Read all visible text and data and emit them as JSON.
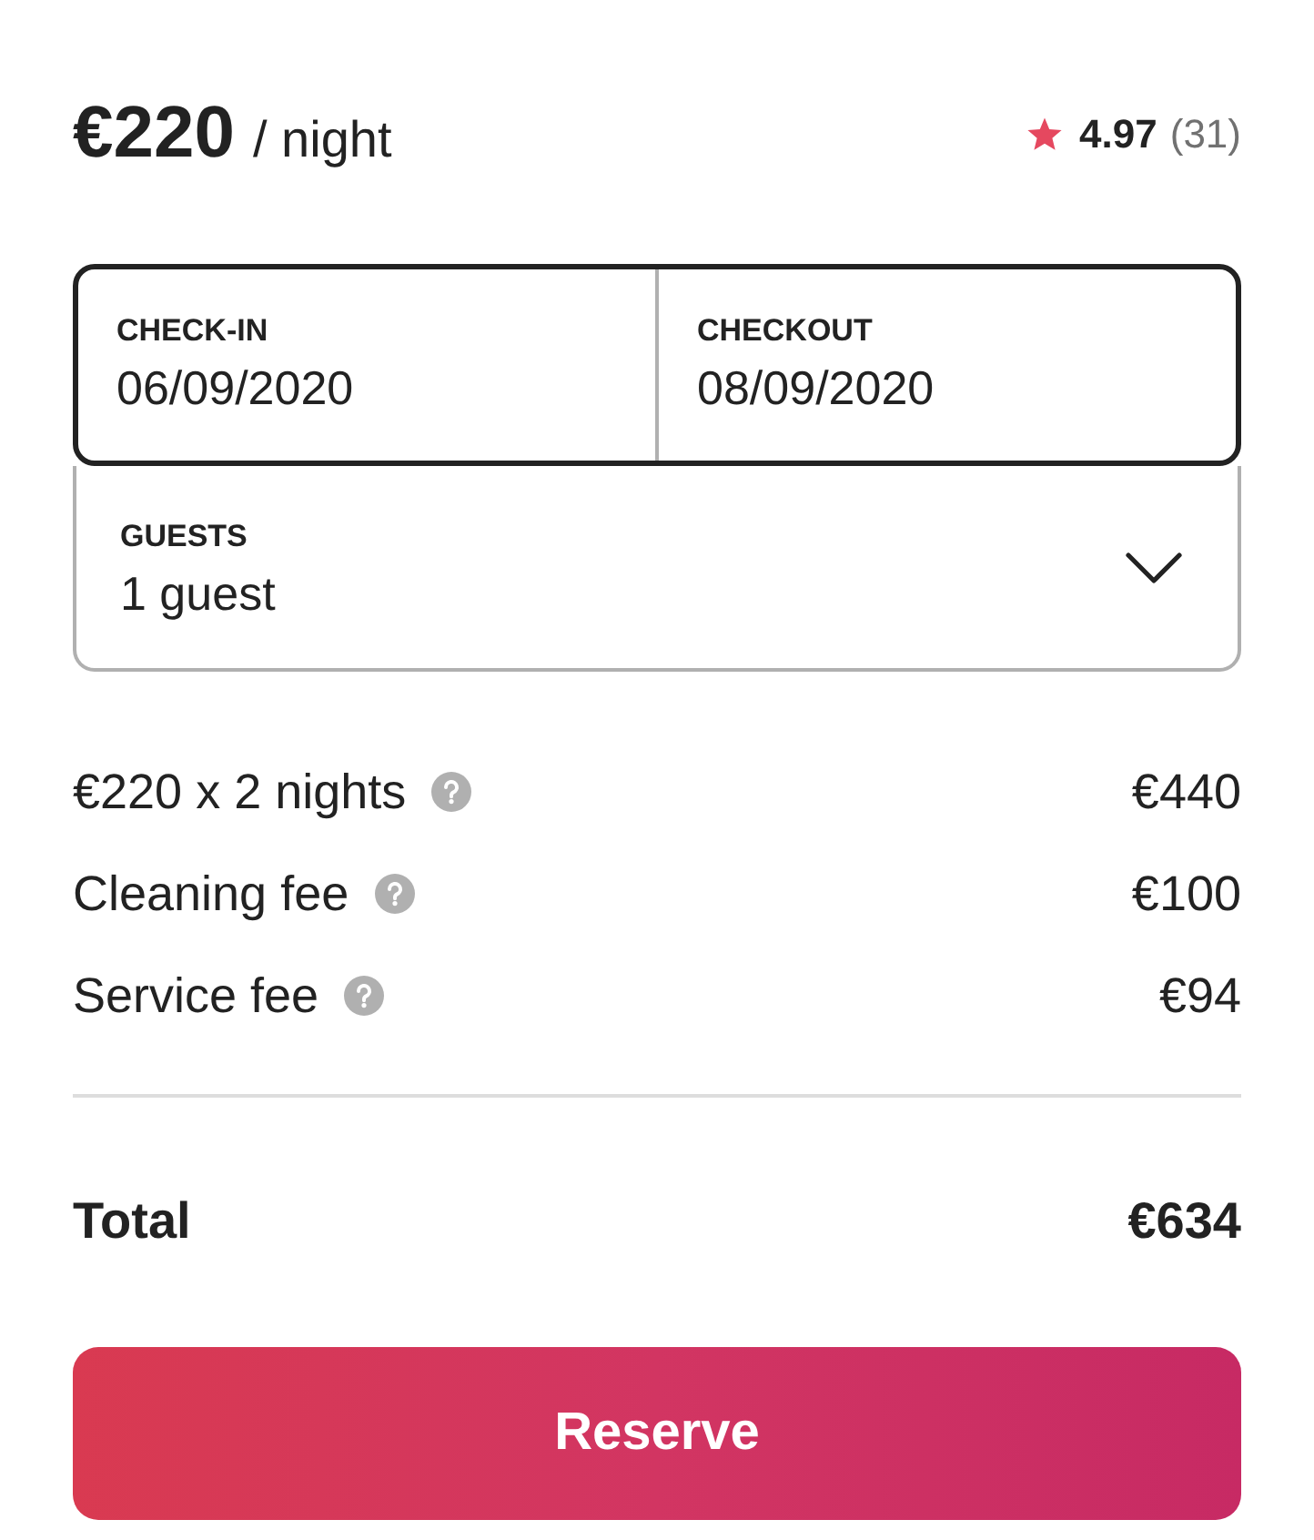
{
  "header": {
    "price": "€220",
    "unit": "/ night",
    "rating": "4.97",
    "reviews": "(31)"
  },
  "dates": {
    "focused": true,
    "fields": [
      {
        "label": "CHECK-IN",
        "value": "06/09/2020"
      },
      {
        "label": "CHECKOUT",
        "value": "08/09/2020"
      }
    ]
  },
  "guests": {
    "focused": false,
    "label": "GUESTS",
    "value": "1 guest"
  },
  "line_items": [
    {
      "label": "€220 x 2 nights",
      "amount": "€440",
      "info": true
    },
    {
      "label": "Cleaning fee",
      "amount": "€100",
      "info": true
    },
    {
      "label": "Service fee",
      "amount": "€94",
      "info": true
    }
  ],
  "total": {
    "label": "Total",
    "amount": "€634"
  },
  "button": {
    "label": "Reserve"
  }
}
